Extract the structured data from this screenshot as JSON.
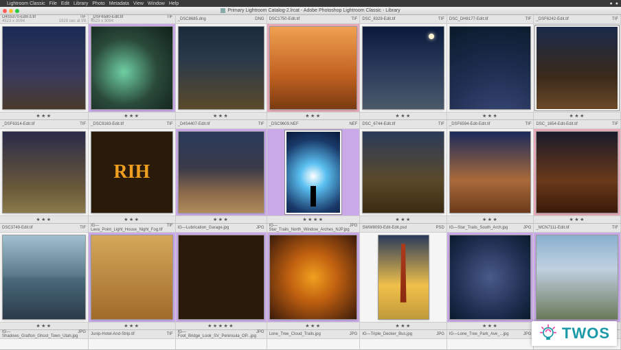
{
  "menubar": {
    "apple": "",
    "items": [
      "Lightroom Classic",
      "File",
      "Edit",
      "Library",
      "Photo",
      "Metadata",
      "View",
      "Window",
      "Help"
    ]
  },
  "titlebar": {
    "title": "Primary Lightroom Catalog-2.lrcat - Adobe Photoshop Lightroom Classic - Library"
  },
  "grid": {
    "images": [
      {
        "filename": "D4S5370-Edit-3.tif",
        "badge": "TIF",
        "dims": "4523 x 3094",
        "meta": "1928 sec at f/8",
        "rating": 3,
        "flag": "",
        "orientation": "landscape",
        "thumb": "sky-night"
      },
      {
        "filename": "_DSF6580-Edit.tif",
        "badge": "TIF",
        "dims": "4523 x 3094",
        "meta": "",
        "rating": 3,
        "flag": "purple",
        "orientation": "landscape",
        "thumb": "city1"
      },
      {
        "filename": "_DSC8685.dng",
        "badge": "DNG",
        "dims": "",
        "meta": "",
        "rating": 3,
        "flag": "",
        "orientation": "landscape",
        "thumb": "city2"
      },
      {
        "filename": "DSC1750-Edit.tif",
        "badge": "TIF",
        "dims": "",
        "meta": "",
        "rating": 3,
        "flag": "pink",
        "orientation": "landscape",
        "thumb": "dino"
      },
      {
        "filename": "DSC_8329-Edit.tif",
        "badge": "TIF",
        "dims": "",
        "meta": "",
        "rating": 3,
        "flag": "",
        "orientation": "landscape",
        "thumb": "bridge-moon"
      },
      {
        "filename": "DSC_DH8177-Edit.tif",
        "badge": "TIF",
        "dims": "",
        "meta": "",
        "rating": 3,
        "flag": "",
        "orientation": "landscape",
        "thumb": "startrails1"
      },
      {
        "filename": "_DSF6242-Edit.tif",
        "badge": "TIF",
        "dims": "",
        "meta": "",
        "rating": 3,
        "flag": "",
        "orientation": "landscape",
        "thumb": "canyon-night",
        "selected": true
      },
      {
        "filename": "_DSF6314-Edit.tif",
        "badge": "TIF",
        "dims": "",
        "meta": "",
        "rating": 3,
        "flag": "",
        "orientation": "landscape",
        "thumb": "rocks-night"
      },
      {
        "filename": "_DSC9163-Edit.tif",
        "badge": "TIF",
        "dims": "",
        "meta": "",
        "rating": 3,
        "flag": "",
        "orientation": "landscape",
        "thumb": "rih"
      },
      {
        "filename": "_D4S4407-Edit.tif",
        "badge": "TIF",
        "dims": "",
        "meta": "",
        "rating": 3,
        "flag": "purple",
        "orientation": "landscape",
        "thumb": "dune-trails"
      },
      {
        "filename": "_DSC9609.NEF",
        "badge": "NEF",
        "dims": "",
        "meta": "",
        "rating": 4,
        "flag": "purple",
        "orientation": "portrait",
        "thumb": "silhouette",
        "selected": true
      },
      {
        "filename": "DSC_6744-Edit.tif",
        "badge": "TIF",
        "dims": "",
        "meta": "",
        "rating": 3,
        "flag": "",
        "orientation": "landscape",
        "thumb": "cabin"
      },
      {
        "filename": "_DSF6594-Edit-Edit.tif",
        "badge": "TIF",
        "dims": "",
        "meta": "",
        "rating": 3,
        "flag": "",
        "orientation": "landscape",
        "thumb": "zion"
      },
      {
        "filename": "DSC_1654-Edit-Edit.tif",
        "badge": "TIF",
        "dims": "",
        "meta": "",
        "rating": 3,
        "flag": "pink",
        "orientation": "landscape",
        "thumb": "zion2"
      },
      {
        "filename": "DSC3749-Edit.tif",
        "badge": "TIF",
        "dims": "",
        "meta": "",
        "rating": 3,
        "flag": "",
        "orientation": "landscape",
        "thumb": "lake-mirror"
      },
      {
        "filename": "IG—Lava_Point_Light_House_Night_Fog.tif",
        "badge": "TIF",
        "dims": "",
        "meta": "",
        "rating": 3,
        "flag": "purple",
        "orientation": "landscape",
        "thumb": "lighthouse"
      },
      {
        "filename": "IG—Lubrication_Garage.jpg",
        "badge": "JPG",
        "dims": "",
        "meta": "",
        "rating": 5,
        "flag": "purple",
        "orientation": "landscape",
        "thumb": "garage"
      },
      {
        "filename": "IG—Star_Trails_North_Window_Arches_NJP.jpg",
        "badge": "JPG",
        "dims": "",
        "meta": "",
        "rating": 3,
        "flag": "purple",
        "orientation": "landscape",
        "thumb": "arch"
      },
      {
        "filename": "SWW8093-Edit-Edit.psd",
        "badge": "PSD",
        "dims": "",
        "meta": "",
        "rating": 3,
        "flag": "",
        "orientation": "portrait",
        "thumb": "ggbridge"
      },
      {
        "filename": "IG—Star_Trails_South_Arch.jpg",
        "badge": "JPG",
        "dims": "",
        "meta": "",
        "rating": 3,
        "flag": "purple",
        "orientation": "landscape",
        "thumb": "startrails2"
      },
      {
        "filename": "_MCN7111-Edit.tif",
        "badge": "TIF",
        "dims": "",
        "meta": "",
        "rating": 3,
        "flag": "purple",
        "orientation": "landscape",
        "thumb": "clouds-trails"
      },
      {
        "filename": "IG—Shadows_Grafton_Ghost_Town_Utah.jpg",
        "badge": "JPG",
        "dims": "",
        "meta": "",
        "rating": 0,
        "flag": "purple",
        "orientation": "landscape",
        "thumb": "ghost"
      },
      {
        "filename": "Junip-Hotel-And-Strip.tif",
        "badge": "TIF",
        "dims": "",
        "meta": "",
        "rating": 0,
        "flag": "",
        "orientation": "landscape",
        "thumb": "junip"
      },
      {
        "filename": "IG—Foot_Bridge_Look_SV_Peninsula_OP...jpg",
        "badge": "JPG",
        "dims": "",
        "meta": "",
        "rating": 0,
        "flag": "purple",
        "orientation": "landscape",
        "thumb": "foot-br"
      },
      {
        "filename": "Lone_Tree_Cloud_Trails.jpg",
        "badge": "JPG",
        "dims": "",
        "meta": "",
        "rating": 0,
        "flag": "purple",
        "orientation": "landscape",
        "thumb": "tree"
      },
      {
        "filename": "IG—Triple_Decker_Bus.jpg",
        "badge": "JPG",
        "dims": "",
        "meta": "",
        "rating": 0,
        "flag": "",
        "orientation": "landscape",
        "thumb": "triple"
      },
      {
        "filename": "IG—Lone_Tree_Park_Ave_...jpg",
        "badge": "JPG",
        "dims": "",
        "meta": "",
        "rating": 0,
        "flag": "purple",
        "orientation": "landscape",
        "thumb": "cloud2"
      },
      {
        "filename": "",
        "badge": "",
        "dims": "",
        "meta": "",
        "rating": 0,
        "flag": "",
        "orientation": "landscape",
        "thumb": ""
      }
    ]
  },
  "overlay": {
    "brand": "TWOS"
  }
}
